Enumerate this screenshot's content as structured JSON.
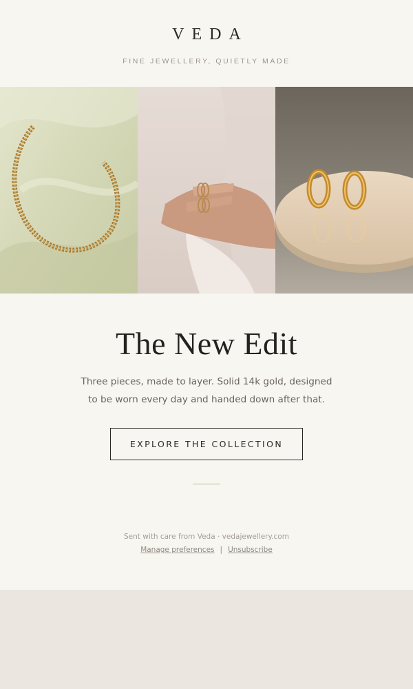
{
  "header": {
    "brand": "VEDA",
    "tagline": "FINE JEWELLERY, QUIETLY MADE"
  },
  "gallery": [
    {
      "subject": "necklace"
    },
    {
      "subject": "rings"
    },
    {
      "subject": "earrings"
    }
  ],
  "hero": {
    "headline": "The New Edit",
    "body_line_1": "Three pieces, made to layer. Solid 14k gold, designed",
    "body_line_2": "to be worn every day and handed down after that.",
    "cta_label": "EXPLORE THE COLLECTION"
  },
  "footer": {
    "sent_line": "Sent with care from Veda · vedajewellery.com",
    "manage_label": "Manage preferences",
    "separator": "|",
    "unsubscribe_label": "Unsubscribe"
  },
  "colors": {
    "page_bg": "#f8f6f1",
    "outer_bg": "#ebe6e0",
    "ink": "#2b2926",
    "muted": "#9c958b",
    "gold_rule": "#c9b58f"
  }
}
